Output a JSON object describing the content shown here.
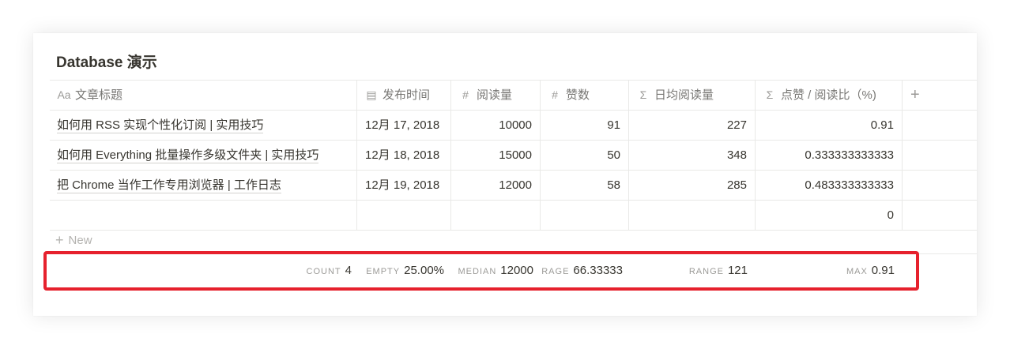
{
  "page": {
    "title": "Database 演示"
  },
  "columns": [
    {
      "icon": "text-type-icon",
      "glyph": "Aa",
      "label": "文章标题"
    },
    {
      "icon": "calendar-icon",
      "glyph": "▤",
      "label": "发布时间"
    },
    {
      "icon": "number-icon",
      "glyph": "#",
      "label": "阅读量"
    },
    {
      "icon": "number-icon",
      "glyph": "#",
      "label": "赞数"
    },
    {
      "icon": "formula-icon",
      "glyph": "Σ",
      "label": "日均阅读量"
    },
    {
      "icon": "formula-icon",
      "glyph": "Σ",
      "label": "点赞 / 阅读比（%)"
    }
  ],
  "add_column_label": "+",
  "rows": [
    {
      "title": "如何用 RSS 实现个性化订阅 | 实用技巧",
      "date": "12月 17, 2018",
      "reads": "10000",
      "likes": "91",
      "daily": "227",
      "ratio": "0.91"
    },
    {
      "title": "如何用 Everything 批量操作多级文件夹 | 实用技巧",
      "date": "12月 18, 2018",
      "reads": "15000",
      "likes": "50",
      "daily": "348",
      "ratio": "0.333333333333"
    },
    {
      "title": "把 Chrome 当作工作专用浏览器 | 工作日志",
      "date": "12月 19, 2018",
      "reads": "12000",
      "likes": "58",
      "daily": "285",
      "ratio": "0.483333333333"
    },
    {
      "title": "",
      "date": "",
      "reads": "",
      "likes": "",
      "daily": "",
      "ratio": "0"
    }
  ],
  "new_row": {
    "plus": "+",
    "label": "New"
  },
  "calculations": {
    "title": {
      "label": "COUNT",
      "value": "4"
    },
    "date": {
      "label": "EMPTY",
      "value": "25.00%"
    },
    "reads": {
      "label": "MEDIAN",
      "value": "12000"
    },
    "likes": {
      "label": "RAGE",
      "value": "66.33333"
    },
    "daily": {
      "label": "RANGE",
      "value": "121"
    },
    "ratio": {
      "label": "MAX",
      "value": "0.91"
    }
  },
  "colors": {
    "highlight_border": "#e6212d",
    "text": "#37352f",
    "muted": "#9b9a97",
    "grid": "#e9e9e7"
  }
}
